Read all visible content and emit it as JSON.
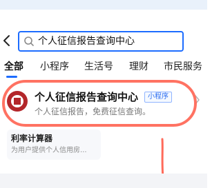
{
  "search": {
    "query": "个人征信报告查询中心"
  },
  "tabs": [
    {
      "label": "全部"
    },
    {
      "label": "小程序"
    },
    {
      "label": "生活号"
    },
    {
      "label": "理财"
    },
    {
      "label": "市民服务"
    }
  ],
  "result": {
    "title": "个人征信报告查询中心",
    "badge": "小程序",
    "description": "个人征信报告，免费征信查询。"
  },
  "secondary": {
    "title": "利率计算器",
    "description": "为用户提供个人信用房..."
  },
  "colors": {
    "accent": "#1c6cff",
    "annotation": "#ff6a5a",
    "logo": "#b3262a"
  }
}
